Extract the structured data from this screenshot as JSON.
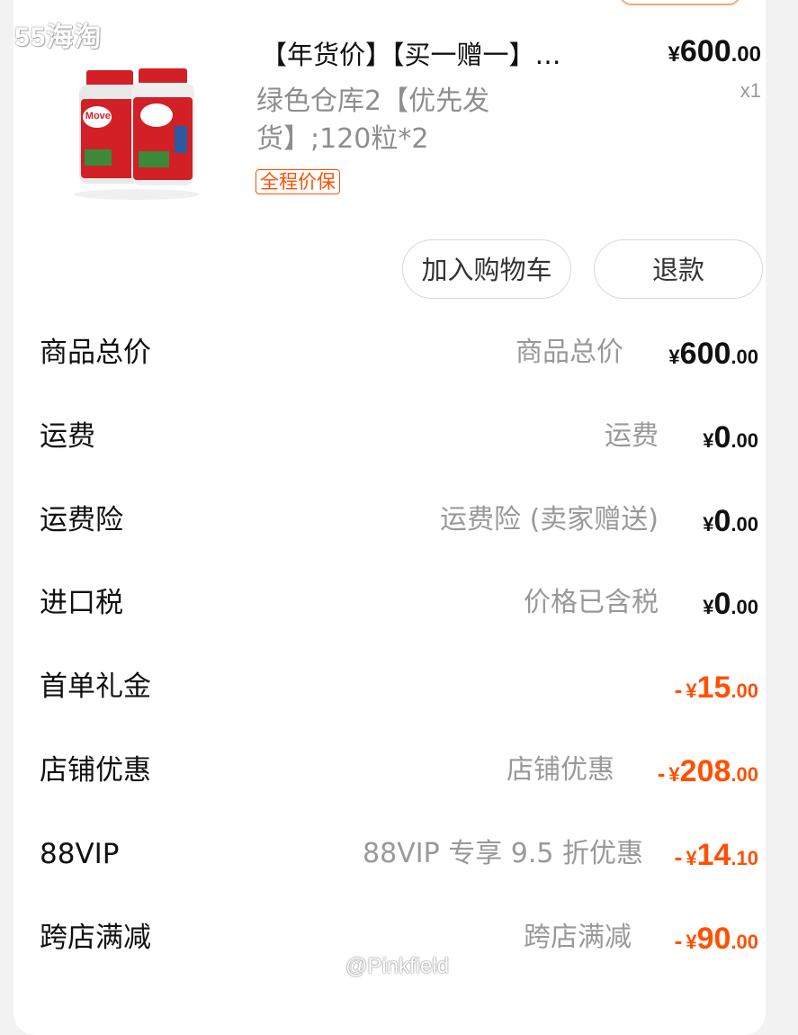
{
  "watermark_top": "55海淘",
  "watermark_bottom": "@Pinkfield",
  "product": {
    "title": "【年货价】【买一赠一】…",
    "spec": "绿色仓库2【优先发货】;120粒*2",
    "badge": "全程价保",
    "price_currency": "¥",
    "price_int": "600",
    "price_dec": ".00",
    "quantity": "x1",
    "image_label": "Move Free"
  },
  "actions": {
    "add_to_cart": "加入购物车",
    "refund": "退款"
  },
  "summary": [
    {
      "label": "商品总价",
      "desc": "商品总价",
      "sign": "",
      "currency": "¥",
      "int": "600",
      "dec": ".00",
      "color": "black"
    },
    {
      "label": "运费",
      "desc": "运费",
      "sign": "",
      "currency": "¥",
      "int": "0",
      "dec": ".00",
      "color": "black"
    },
    {
      "label": "运费险",
      "desc": "运费险 (卖家赠送)",
      "sign": "",
      "currency": "¥",
      "int": "0",
      "dec": ".00",
      "color": "black"
    },
    {
      "label": "进口税",
      "desc": "价格已含税",
      "sign": "",
      "currency": "¥",
      "int": "0",
      "dec": ".00",
      "color": "black"
    },
    {
      "label": "首单礼金",
      "desc": "",
      "sign": "-",
      "currency": "¥",
      "int": "15",
      "dec": ".00",
      "color": "orange"
    },
    {
      "label": "店铺优惠",
      "desc": "店铺优惠",
      "sign": "-",
      "currency": "¥",
      "int": "208",
      "dec": ".00",
      "color": "orange"
    },
    {
      "label": "88VIP",
      "desc": "88VIP 专享 9.5 折优惠",
      "sign": "-",
      "currency": "¥",
      "int": "14",
      "dec": ".10",
      "color": "orange"
    },
    {
      "label": "跨店满减",
      "desc": "跨店满减",
      "sign": "-",
      "currency": "¥",
      "int": "90",
      "dec": ".00",
      "color": "orange"
    }
  ],
  "colors": {
    "accent": "#ff5000",
    "muted": "#999999"
  }
}
